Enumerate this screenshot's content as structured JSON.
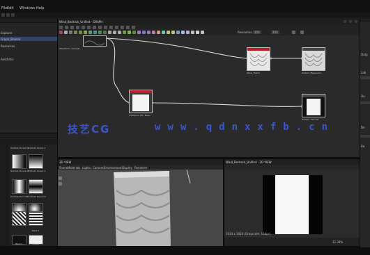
{
  "menu": {
    "items": [
      "File",
      "Edit",
      "Windows",
      "Help"
    ]
  },
  "explorer": {
    "title": "Explorer",
    "items": [
      "Untitled_Package",
      "Graph_Breeze",
      "Resources",
      "Aesthetic"
    ]
  },
  "graph": {
    "title": "Wind_Bedrock_Unified - GRAPH",
    "toolbar_label": "Resolution",
    "res_value_1": "256",
    "res_value_2": "256",
    "nodes": [
      {
        "label": "Waveform / Sample"
      },
      {
        "label": "Transform 2D / Base"
      },
      {
        "label": "Warp / Fabric"
      },
      {
        "label": "Output / Basecolor"
      },
      {
        "label": "Output / Normal"
      }
    ]
  },
  "watermark": {
    "text1": "技艺CG",
    "text2": "www.qdnxxfb.cn"
  },
  "library": {
    "items": [
      {
        "label": "Gradient Linear 1"
      },
      {
        "label": "Gradient Linear 2"
      },
      {
        "label": "Gradient Linear 3"
      },
      {
        "label": "Gradient Linear 4"
      },
      {
        "label": "Gradient Circular"
      },
      {
        "label": "Gradient Dynamic"
      },
      {
        "label": "Fabric 1"
      },
      {
        "label": "Mask 1"
      },
      {
        "label": "Mask 2"
      },
      {
        "label": "Shape"
      }
    ]
  },
  "view3d": {
    "title": "3D VIEW",
    "menu": [
      "Scene",
      "Materials",
      "Lights",
      "Camera",
      "Environment",
      "Display",
      "Renderer"
    ]
  },
  "view2d": {
    "title": "Wind_Bedrock_Unified - 2D VIEW",
    "status": "1024 x 1024 (Grayscale, 16bpc)",
    "zoom": "12.39%"
  },
  "properties": {
    "title": "Properties",
    "labels": [
      "Outp",
      "Lab",
      "Ou",
      "De",
      "Ba"
    ]
  },
  "colors": {
    "accent": "#3b56c9",
    "graph_bg": "#2a2a2a",
    "node_red": "#b8202a"
  }
}
